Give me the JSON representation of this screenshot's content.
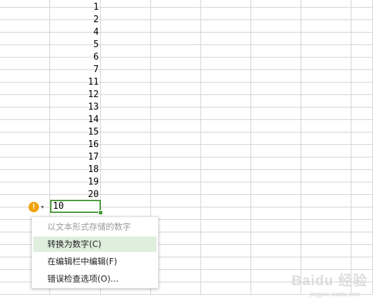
{
  "sheet": {
    "column_b_values": [
      "1",
      "2",
      "4",
      "5",
      "6",
      "7",
      "11",
      "12",
      "13",
      "14",
      "15",
      "16",
      "17",
      "18",
      "19",
      "20"
    ],
    "active_cell_value": "10"
  },
  "error_indicator": {
    "icon": "warning-exclamation-icon",
    "glyph": "!",
    "caret": "▾",
    "color": "#f0a30a"
  },
  "context_menu": {
    "items": [
      {
        "label": "以文本形式存储的数字",
        "disabled": true
      },
      {
        "label": "转换为数字(C)",
        "highlighted": true
      },
      {
        "label": "在编辑栏中编辑(F)"
      },
      {
        "label": "错误检查选项(O)..."
      }
    ]
  },
  "watermark": {
    "main": "Baidu 经验",
    "sub": "jingyan.baidu.com"
  },
  "colors": {
    "selection_border": "#4a9a3a",
    "menu_highlight": "#dfeedd",
    "gridline": "#d4d4d4"
  }
}
